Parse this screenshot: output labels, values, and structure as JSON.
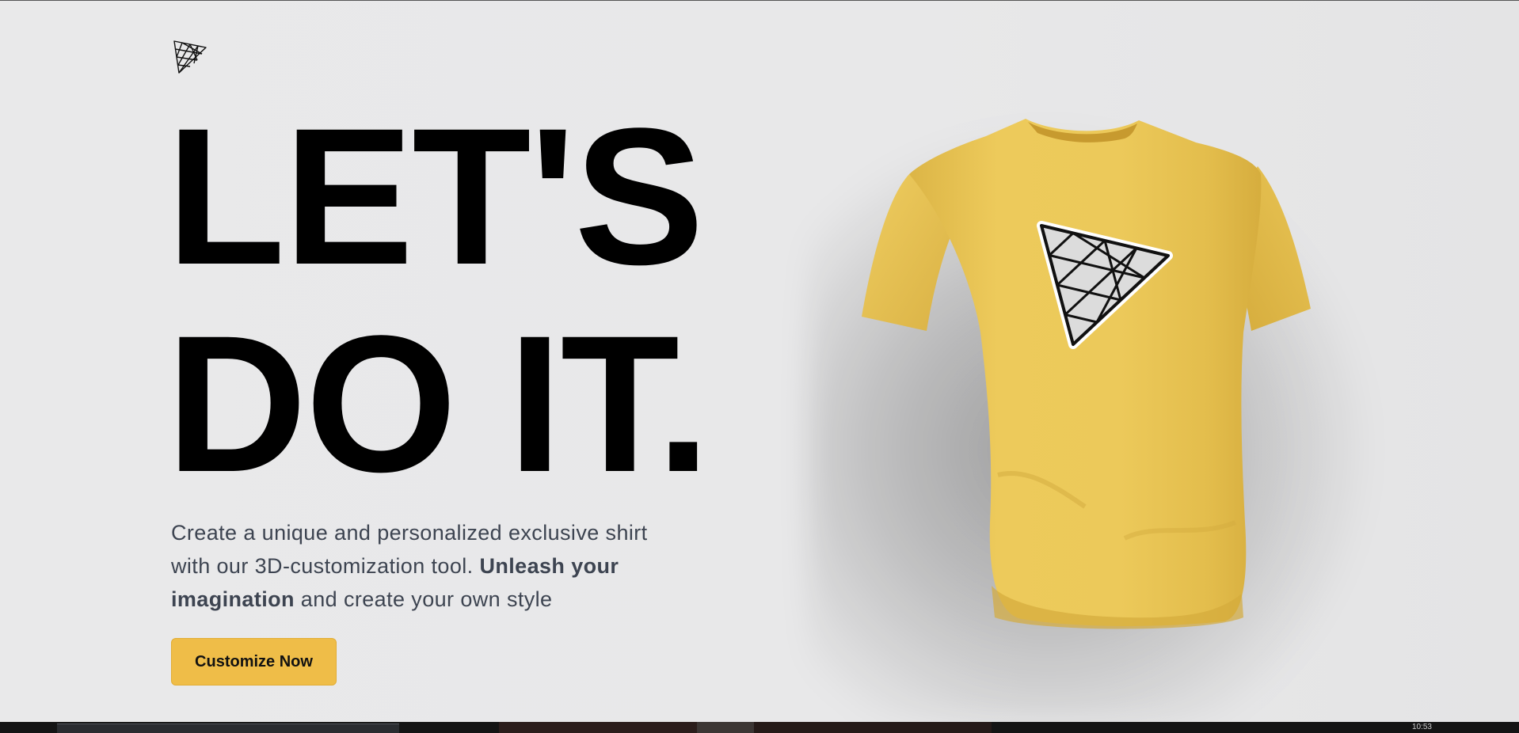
{
  "logo": {
    "icon": "triangle-mesh-icon"
  },
  "hero": {
    "headline_line1": "LET'S",
    "headline_line2": "DO IT.",
    "description_part1": "Create a unique and personalized exclusive shirt with our 3D-customization tool. ",
    "description_bold": "Unleash your imagination",
    "description_part2": " and create your own style",
    "cta_label": "Customize Now"
  },
  "product": {
    "image": "yellow-tshirt-3d",
    "shirt_color": "#ecc95a",
    "decal_icon": "triangle-mesh-icon"
  },
  "colors": {
    "accent": "#efbd48",
    "headline": "#000000",
    "text": "#3d4451",
    "background": "#e8e8e9"
  },
  "taskbar": {
    "clock": "10:53"
  }
}
